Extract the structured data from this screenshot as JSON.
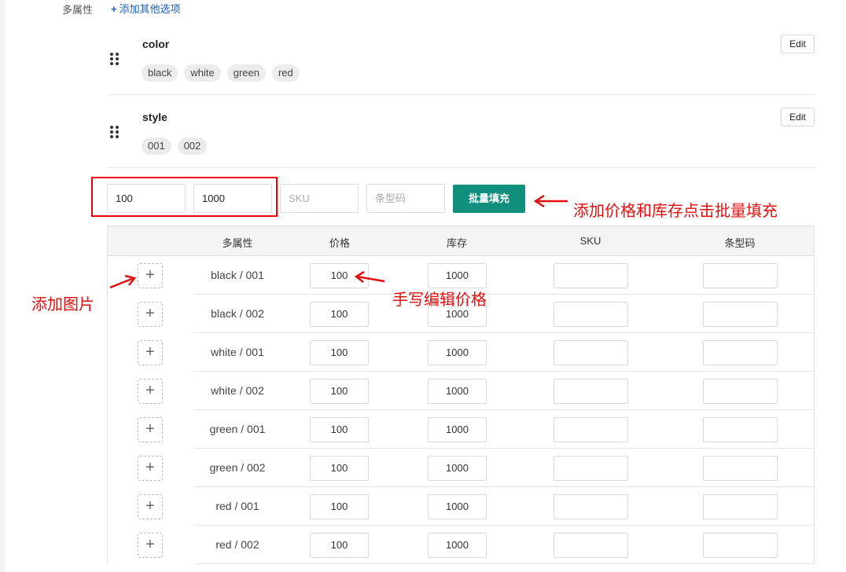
{
  "header": {
    "prop_label": "多属性",
    "add_link_label": "添加其他选项"
  },
  "attributes": [
    {
      "name": "color",
      "values": [
        "black",
        "white",
        "green",
        "red"
      ],
      "edit_label": "Edit"
    },
    {
      "name": "style",
      "values": [
        "001",
        "002"
      ],
      "edit_label": "Edit"
    }
  ],
  "bulk_fill": {
    "price_value": "100",
    "stock_value": "1000",
    "sku_placeholder": "SKU",
    "barcode_placeholder": "条型码",
    "button_label": "批量填充"
  },
  "table": {
    "columns": [
      "多属性",
      "价格",
      "库存",
      "SKU",
      "条型码"
    ],
    "rows": [
      {
        "variant": "black / 001",
        "price": "100",
        "stock": "1000",
        "sku": "",
        "barcode": ""
      },
      {
        "variant": "black / 002",
        "price": "100",
        "stock": "1000",
        "sku": "",
        "barcode": ""
      },
      {
        "variant": "white / 001",
        "price": "100",
        "stock": "1000",
        "sku": "",
        "barcode": ""
      },
      {
        "variant": "white / 002",
        "price": "100",
        "stock": "1000",
        "sku": "",
        "barcode": ""
      },
      {
        "variant": "green / 001",
        "price": "100",
        "stock": "1000",
        "sku": "",
        "barcode": ""
      },
      {
        "variant": "green / 002",
        "price": "100",
        "stock": "1000",
        "sku": "",
        "barcode": ""
      },
      {
        "variant": "red / 001",
        "price": "100",
        "stock": "1000",
        "sku": "",
        "barcode": ""
      },
      {
        "variant": "red / 002",
        "price": "100",
        "stock": "1000",
        "sku": "",
        "barcode": ""
      }
    ],
    "add_image_icon": "plus-icon"
  },
  "annotations": {
    "bulk_fill_note": "添加价格和库存点击批量填充",
    "manual_edit_note": "手写编辑价格",
    "add_image_note": "添加图片"
  },
  "colors": {
    "accent": "#118f7d",
    "annotation": "#e01010",
    "link": "#1a5fb4"
  }
}
